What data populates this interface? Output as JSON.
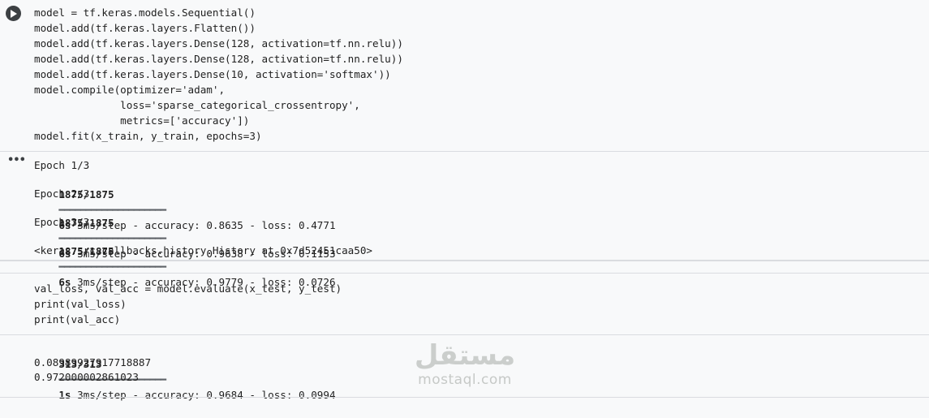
{
  "cell1": {
    "code": [
      "model = tf.keras.models.Sequential()",
      "model.add(tf.keras.layers.Flatten())",
      "model.add(tf.keras.layers.Dense(128, activation=tf.nn.relu))",
      "model.add(tf.keras.layers.Dense(128, activation=tf.nn.relu))",
      "model.add(tf.keras.layers.Dense(10, activation='softmax'))",
      "model.compile(optimizer='adam',",
      "              loss='sparse_categorical_crossentropy',",
      "              metrics=['accuracy'])",
      "model.fit(x_train, y_train, epochs=3)"
    ],
    "output": {
      "epoch1_header": "Epoch 1/3",
      "epoch1_steps": "1875/1875",
      "epoch1_bar": "━━━━━━━━━━━━━━━━━━━━",
      "epoch1_time": "6s",
      "epoch1_rest": " 3ms/step - accuracy: 0.8635 - loss: 0.4771",
      "epoch2_header": "Epoch 2/3",
      "epoch2_steps": "1875/1875",
      "epoch2_bar": "━━━━━━━━━━━━━━━━━━━━",
      "epoch2_time": "6s",
      "epoch2_rest": " 3ms/step - accuracy: 0.9638 - loss: 0.1153",
      "epoch3_header": "Epoch 3/3",
      "epoch3_steps": "1875/1875",
      "epoch3_bar": "━━━━━━━━━━━━━━━━━━━━",
      "epoch3_time": "6s",
      "epoch3_rest": " 3ms/step - accuracy: 0.9779 - loss: 0.0726",
      "history": "<keras.src.callbacks.history.History at 0x7d52451caa50>"
    }
  },
  "cell2": {
    "code": [
      "val_loss, val_acc = model.evaluate(x_test, y_test)",
      "print(val_loss)",
      "print(val_acc)"
    ],
    "output": {
      "steps": "313/313",
      "bar": "━━━━━━━━━━━━━━━━━━━━",
      "time": "1s",
      "rest": " 3ms/step - accuracy: 0.9684 - loss: 0.0994",
      "val_loss": "0.08989927917718887",
      "val_acc": "0.972000002861023"
    }
  },
  "watermark": {
    "logo_text": "مستقل",
    "url": "mostaql.com"
  },
  "icons": {
    "run": "play-circle-icon",
    "output_menu": "more-horiz-icon"
  }
}
